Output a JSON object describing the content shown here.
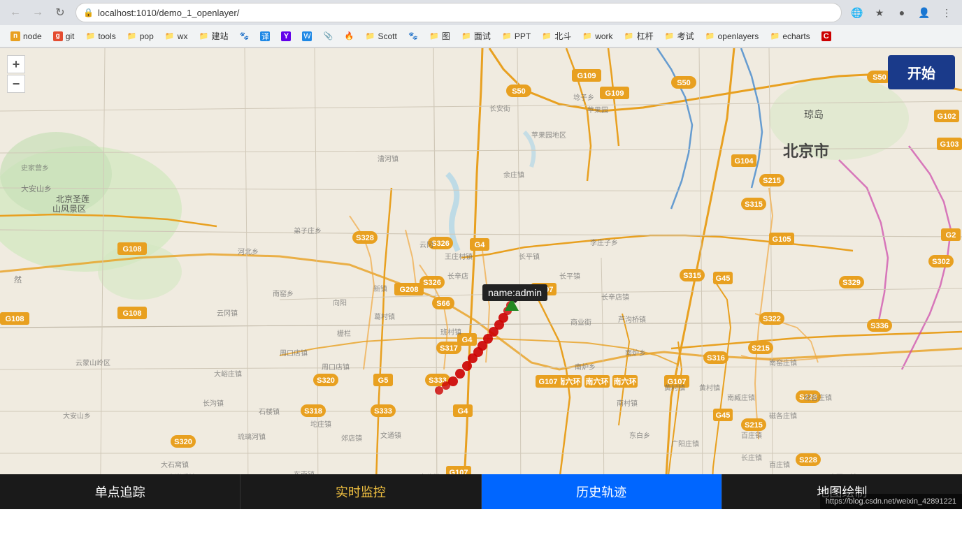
{
  "browser": {
    "url": "localhost:1010/demo_1_openlayer/",
    "nav_back": "←",
    "nav_forward": "→",
    "nav_refresh": "↻"
  },
  "bookmarks": [
    {
      "id": "node",
      "label": "node",
      "icon_class": "bm-node"
    },
    {
      "id": "git",
      "label": "git",
      "icon_class": "bm-git"
    },
    {
      "id": "tools",
      "label": "tools",
      "icon_class": "bm-tools"
    },
    {
      "id": "pop",
      "label": "pop",
      "icon_class": "bm-pop"
    },
    {
      "id": "wx",
      "label": "wx",
      "icon_class": "bm-wx"
    },
    {
      "id": "jianzhan",
      "label": "建站",
      "icon_class": "bm-jianzhan"
    },
    {
      "id": "yi",
      "label": "译",
      "icon_class": "bm-yi"
    },
    {
      "id": "yahoo",
      "label": "Y",
      "icon_class": "bm-yahoo"
    },
    {
      "id": "w",
      "label": "W",
      "icon_class": "bm-w"
    },
    {
      "id": "clip",
      "label": "🔗",
      "icon_class": "bm-clip"
    },
    {
      "id": "fire",
      "label": "🔥",
      "icon_class": "bm-fire"
    },
    {
      "id": "scott",
      "label": "Scott",
      "icon_class": "bm-scott"
    },
    {
      "id": "tu",
      "label": "图",
      "icon_class": "bm-tu"
    },
    {
      "id": "mianshi",
      "label": "面试",
      "icon_class": "bm-mianshi"
    },
    {
      "id": "ppt",
      "label": "PPT",
      "icon_class": "bm-ppt"
    },
    {
      "id": "beidu",
      "label": "北斗",
      "icon_class": "bm-beidu"
    },
    {
      "id": "work",
      "label": "work",
      "icon_class": "bm-work"
    },
    {
      "id": "gangan",
      "label": "杠杆",
      "icon_class": "bm-gangan"
    },
    {
      "id": "kaoshi",
      "label": "考试",
      "icon_class": "bm-kaoshi"
    },
    {
      "id": "openlayers",
      "label": "openlayers",
      "icon_class": "bm-openlayers"
    },
    {
      "id": "echarts",
      "label": "echarts",
      "icon_class": "bm-echarts"
    },
    {
      "id": "csdn",
      "label": "C",
      "icon_class": "bm-csdn"
    }
  ],
  "map": {
    "tooltip_text": "name:admin",
    "zoom_in": "+",
    "zoom_out": "−",
    "start_button": "开始"
  },
  "tabs": [
    {
      "id": "single-track",
      "label": "单点追踪",
      "active": false
    },
    {
      "id": "realtime-monitor",
      "label": "实时监控",
      "active": false
    },
    {
      "id": "history-track",
      "label": "历史轨迹",
      "active": true
    },
    {
      "id": "map-draw",
      "label": "地图绘制",
      "active": false
    }
  ],
  "status_bar": {
    "url": "https://blog.csdn.net/weixin_42891221"
  },
  "road_labels": {
    "g109_top": "G109",
    "s50_top": "S50",
    "g108_left": "G108",
    "g108_mid": "G108",
    "s328": "S328",
    "s326_top": "S326",
    "s50_mid": "S50",
    "g4_top": "G4",
    "g107_mid": "G107",
    "g5_mid": "G5",
    "s317": "S317",
    "s333": "S333",
    "s326_mid": "S326",
    "g208": "G208",
    "s66": "S66",
    "s315_top": "S315",
    "g45_right": "G45",
    "s215_right": "S215",
    "g107_right": "G107",
    "s316": "S316",
    "g45_bottom": "G45",
    "g107_bottom": "G107"
  }
}
